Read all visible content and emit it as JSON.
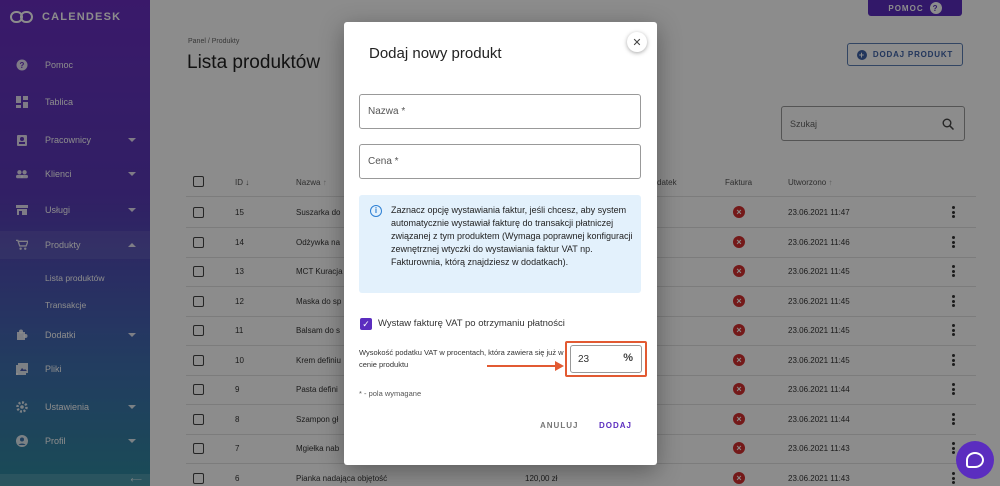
{
  "app": {
    "brand": "CALENDESK"
  },
  "header": {
    "help_label": "POMOC",
    "add_product_label": "DODAJ PRODUKT"
  },
  "sidebar": {
    "items": [
      {
        "label": "Pomoc",
        "icon": "help-circle-icon"
      },
      {
        "label": "Tablica",
        "icon": "dashboard-icon"
      },
      {
        "label": "Pracownicy",
        "icon": "badge-icon"
      },
      {
        "label": "Klienci",
        "icon": "people-icon"
      },
      {
        "label": "Usługi",
        "icon": "store-icon"
      },
      {
        "label": "Produkty",
        "icon": "cart-icon"
      },
      {
        "label": "Dodatki",
        "icon": "puzzle-icon"
      },
      {
        "label": "Pliki",
        "icon": "image-icon"
      },
      {
        "label": "Ustawienia",
        "icon": "gear-icon"
      },
      {
        "label": "Profil",
        "icon": "account-icon"
      }
    ],
    "sub_items": [
      "Lista produktów",
      "Transakcje"
    ]
  },
  "page": {
    "breadcrumb": "Panel / Produkty",
    "title": "Lista produktów",
    "search_placeholder": "Szukaj"
  },
  "table": {
    "headers": {
      "id": "ID",
      "name": "Nazwa",
      "tax": "datek",
      "invoice": "Faktura",
      "created": "Utworzono"
    },
    "rows": [
      {
        "id": "15",
        "name": "Suszarka do",
        "created": "23.06.2021 11:47"
      },
      {
        "id": "14",
        "name": "Odżywka na",
        "created": "23.06.2021 11:46"
      },
      {
        "id": "13",
        "name": "MCT Kuracja",
        "created": "23.06.2021 11:45"
      },
      {
        "id": "12",
        "name": "Maska do sp",
        "created": "23.06.2021 11:45"
      },
      {
        "id": "11",
        "name": "Balsam do s",
        "created": "23.06.2021 11:45"
      },
      {
        "id": "10",
        "name": "Krem definiu",
        "created": "23.06.2021 11:45"
      },
      {
        "id": "9",
        "name": "Pasta defini",
        "created": "23.06.2021 11:44"
      },
      {
        "id": "8",
        "name": "Szampon gł",
        "created": "23.06.2021 11:44"
      },
      {
        "id": "7",
        "name": "Mgiełka nab",
        "created": "23.06.2021 11:43"
      },
      {
        "id": "6",
        "name": "Pianka nadająca objętość",
        "price": "120,00 zł",
        "created": "23.06.2021 11:43"
      }
    ]
  },
  "dialog": {
    "title": "Dodaj nowy produkt",
    "name_label": "Nazwa *",
    "price_label": "Cena *",
    "info_text": "Zaznacz opcję wystawiania faktur, jeśli chcesz, aby system automatycznie wystawiał fakturę do transakcji płatniczej związanej z tym produktem (Wymaga poprawnej konfiguracji zewnętrznej wtyczki do wystawiania faktur VAT np. Fakturownia, którą znajdziesz w dodatkach).",
    "vat_checkbox_label": "Wystaw fakturę VAT po otrzymaniu płatności",
    "vat_checked": true,
    "vat_description": "Wysokość podatku VAT w procentach, która zawiera się już w cenie produktu",
    "vat_value": "23",
    "vat_suffix": "%",
    "required_note": "* - pola wymagane",
    "cancel_label": "ANULUJ",
    "submit_label": "DODAJ"
  },
  "colors": {
    "primary": "#5b2dbf",
    "danger": "#d32f2f",
    "highlight": "#e25a32",
    "info_bg": "#e3f1fc"
  }
}
